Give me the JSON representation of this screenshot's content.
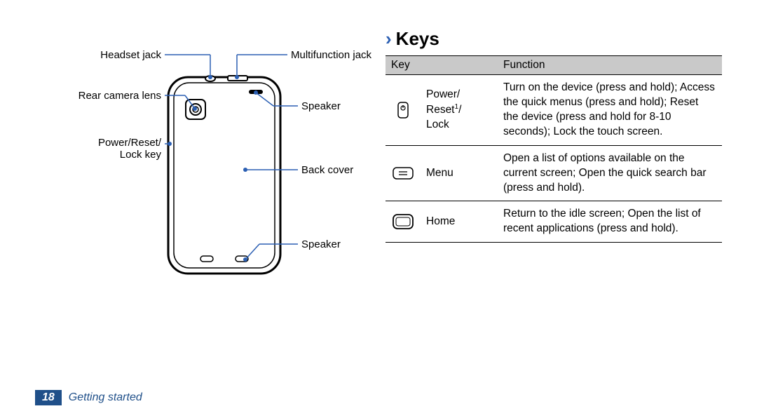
{
  "diagram": {
    "left_labels": [
      "Headset jack",
      "Rear camera lens",
      "Power/Reset/ Lock key"
    ],
    "right_labels": [
      "Multifunction jack",
      "Speaker",
      "Back cover",
      "Speaker"
    ]
  },
  "section": {
    "title": "Keys",
    "table_headers": [
      "Key",
      "Function"
    ],
    "rows": [
      {
        "name_line1": "Power/",
        "name_line2": "Reset",
        "name_sup": "1",
        "name_line3": "/",
        "name_line4": "Lock",
        "function": "Turn on the device (press and hold); Access the quick menus (press and hold); Reset the device (press and hold for 8-10 seconds); Lock the touch screen."
      },
      {
        "name": "Menu",
        "function": "Open a list of options available on the current screen; Open the quick search bar (press and hold)."
      },
      {
        "name": "Home",
        "function": "Return to the idle screen; Open the list of recent applications (press and hold)."
      }
    ]
  },
  "footer": {
    "page_number": "18",
    "section_name": "Getting started"
  }
}
